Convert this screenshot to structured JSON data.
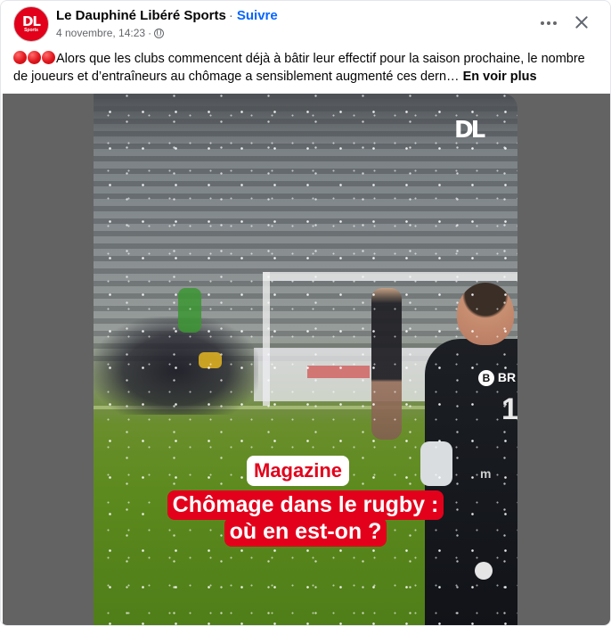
{
  "post": {
    "author": "Le Dauphiné Libéré Sports",
    "follow_label": "Suivre",
    "date": "4 novembre, 14:23",
    "avatar_text": "DL",
    "avatar_subtext": "Sports",
    "body_text": "Alors que les clubs commencent déjà à bâtir leur effectif pour la saison prochaine, le nombre de joueurs et d’entraîneurs au chômage a sensiblement augmenté ces dern…",
    "see_more_label": "En voir plus",
    "leading_emoji_count": 3,
    "icons": {
      "more": "more-horizontal-icon",
      "close": "close-icon",
      "audience": "globe-icon"
    }
  },
  "video": {
    "watermark": "DL",
    "tag": "Magazine",
    "headline_line1": "Chômage dans le rugby :",
    "headline_line2": "où en est-on ?",
    "jersey_sponsor_letter": "B",
    "jersey_sponsor_text": "BR",
    "jersey_number": "1",
    "jersey_side_text": "m"
  },
  "colors": {
    "brand_red": "#e3001b",
    "link_blue": "#0866ff",
    "secondary_text": "#65676b"
  }
}
